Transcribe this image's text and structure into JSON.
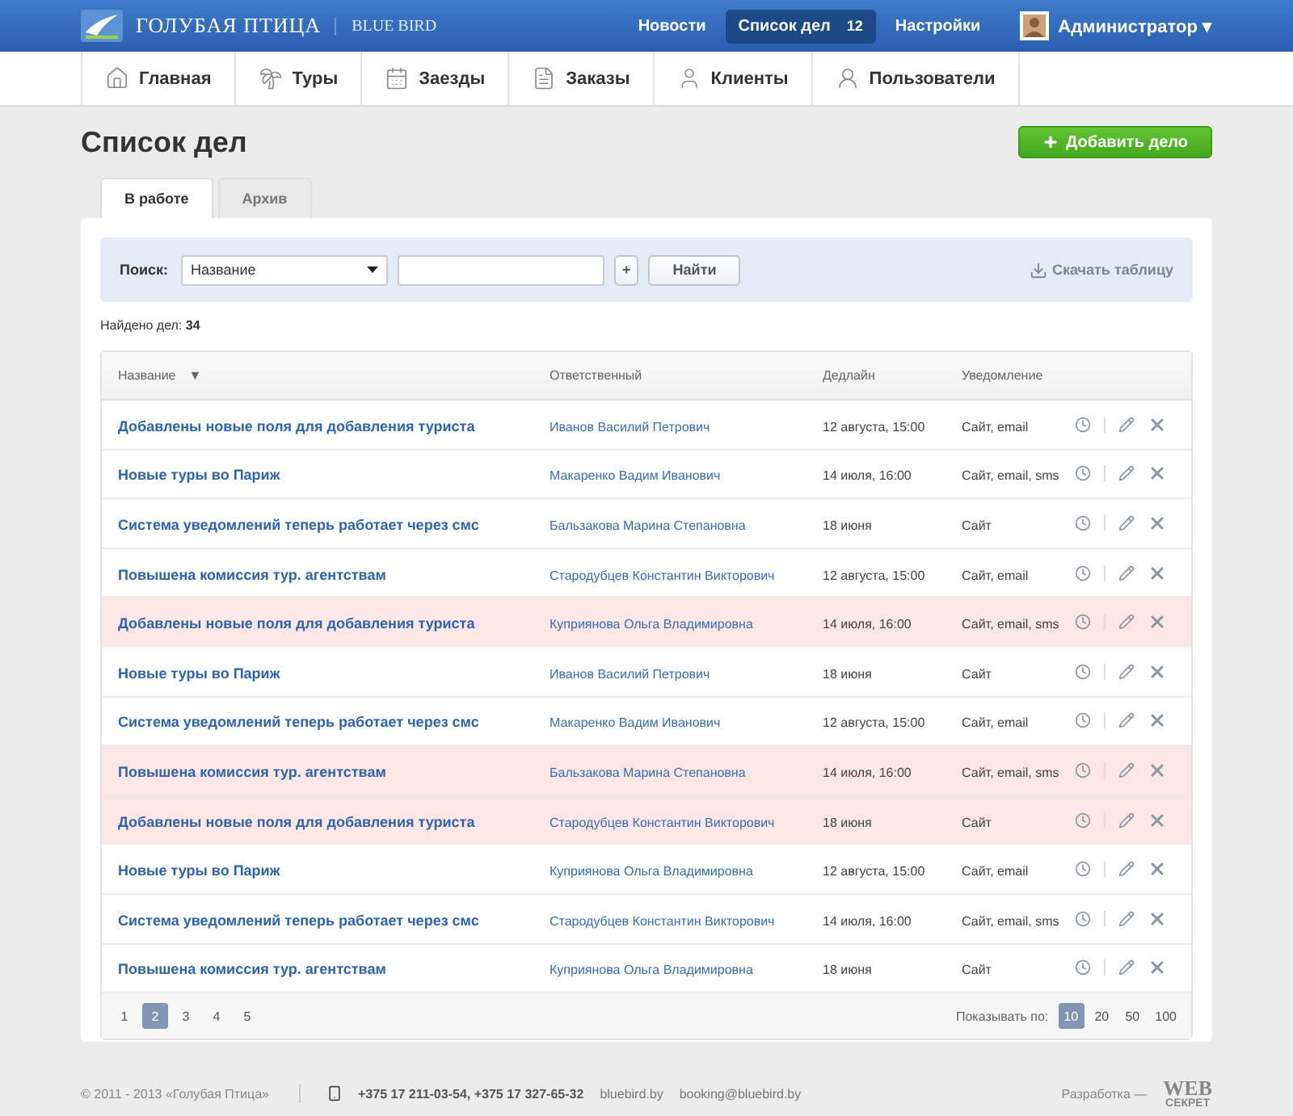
{
  "header": {
    "logo_text": "ГОЛУБАЯ ПТИЦА",
    "logo_subtext": "BLUE BIRD",
    "links": [
      {
        "label": "Новости",
        "selected": false
      },
      {
        "label": "Список дел",
        "badge": "12",
        "selected": true
      },
      {
        "label": "Настройки",
        "selected": false
      }
    ],
    "user": "Администратор",
    "user_caret": "▾"
  },
  "nav": [
    {
      "label": "Главная"
    },
    {
      "label": "Туры"
    },
    {
      "label": "Заезды"
    },
    {
      "label": "Заказы"
    },
    {
      "label": "Клиенты"
    },
    {
      "label": "Пользователи"
    }
  ],
  "page_title": "Список дел",
  "add_button": "Добавить дело",
  "tabs": [
    {
      "label": "В работе",
      "selected": true
    },
    {
      "label": "Архив",
      "selected": false
    }
  ],
  "search": {
    "label": "Поиск:",
    "select_value": "Название",
    "button": "Найти",
    "add": "+",
    "download": "Скачать таблицу"
  },
  "found": {
    "label": "Найдено дел:",
    "count": "34"
  },
  "table": {
    "columns": [
      "Название",
      "Ответственный",
      "Дедлайн",
      "Уведомление"
    ],
    "sort_mark": "▼",
    "rows": [
      {
        "title": "Добавлены новые поля для добавления туриста",
        "owner": "Иванов Василий Петрович",
        "deadline": "12 августа, 15:00",
        "notify": "Сайт, email",
        "overdue": false
      },
      {
        "title": "Новые туры во Париж",
        "owner": "Макаренко Вадим Иванович",
        "deadline": "14 июля, 16:00",
        "notify": "Сайт, email, sms",
        "overdue": false
      },
      {
        "title": "Система уведомлений теперь работает через смс",
        "owner": "Бальзакова Марина Степановна",
        "deadline": "18 июня",
        "notify": "Сайт",
        "overdue": false
      },
      {
        "title": "Повышена комиссия тур. агентствам",
        "owner": "Стародубцев Константин Викторович",
        "deadline": "12 августа, 15:00",
        "notify": "Сайт, email",
        "overdue": false
      },
      {
        "title": "Добавлены новые поля для добавления туриста",
        "owner": "Куприянова Ольга Владимировна",
        "deadline": "14 июля, 16:00",
        "notify": "Сайт, email, sms",
        "overdue": true
      },
      {
        "title": "Новые туры во Париж",
        "owner": "Иванов Василий Петрович",
        "deadline": "18 июня",
        "notify": "Сайт",
        "overdue": false
      },
      {
        "title": "Система уведомлений теперь работает через смс",
        "owner": "Макаренко Вадим Иванович",
        "deadline": "12 августа, 15:00",
        "notify": "Сайт, email",
        "overdue": false
      },
      {
        "title": "Повышена комиссия тур. агентствам",
        "owner": "Бальзакова Марина Степановна",
        "deadline": "14 июля, 16:00",
        "notify": "Сайт, email, sms",
        "overdue": true
      },
      {
        "title": "Добавлены новые поля для добавления туриста",
        "owner": "Стародубцев Константин Викторович",
        "deadline": "18 июня",
        "notify": "Сайт",
        "overdue": true
      },
      {
        "title": "Новые туры во Париж",
        "owner": "Куприянова Ольга Владимировна",
        "deadline": "12 августа, 15:00",
        "notify": "Сайт, email",
        "overdue": false
      },
      {
        "title": "Система уведомлений теперь работает через смс",
        "owner": "Стародубцев Константин Викторович",
        "deadline": "14 июля, 16:00",
        "notify": "Сайт, email, sms",
        "overdue": false
      },
      {
        "title": "Повышена комиссия тур. агентствам",
        "owner": "Куприянова Ольга Владимировна",
        "deadline": "18 июня",
        "notify": "Сайт",
        "overdue": false
      }
    ]
  },
  "pagination": {
    "pages": [
      {
        "label": "1",
        "selected": false
      },
      {
        "label": "2",
        "selected": true
      },
      {
        "label": "3",
        "selected": false
      },
      {
        "label": "4",
        "selected": false
      },
      {
        "label": "5",
        "selected": false
      }
    ],
    "per_page_label": "Показывать по:",
    "per_page": [
      {
        "label": "10",
        "selected": true
      },
      {
        "label": "20",
        "selected": false
      },
      {
        "label": "50",
        "selected": false
      },
      {
        "label": "100",
        "selected": false
      }
    ]
  },
  "footer": {
    "copyright": "© 2011 - 2013 «Голубая Птица»",
    "phones": "+375 17 211-03-54, +375 17 327-65-32",
    "site": "bluebird.by",
    "email": "booking@bluebird.by",
    "dev_label": "Разработка —",
    "dev_logo_top": "WEB",
    "dev_logo_bottom": "СЕКРЕТ"
  }
}
